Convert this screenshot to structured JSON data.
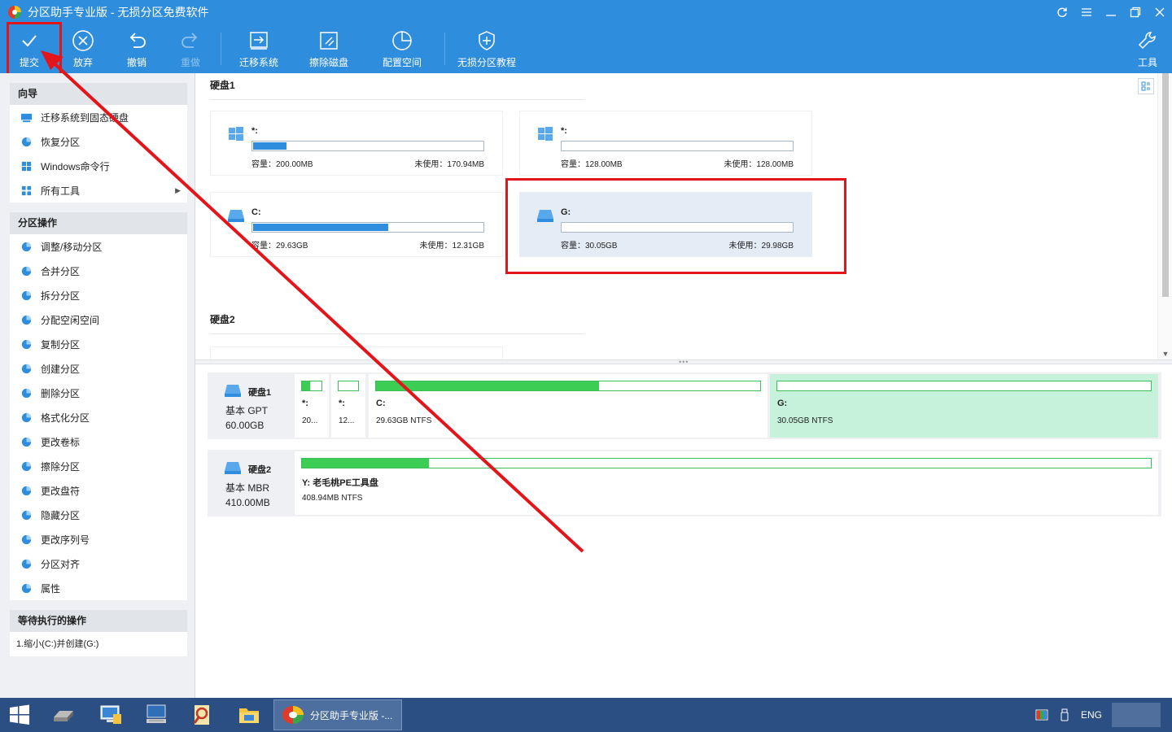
{
  "window": {
    "title": "分区助手专业版 - 无损分区免费软件",
    "controls": [
      "refresh-icon",
      "menu-icon",
      "minimize-icon",
      "restore-icon",
      "close-icon"
    ]
  },
  "toolbar": {
    "submit": "提交",
    "discard": "放弃",
    "undo": "撤销",
    "redo": "重做",
    "migrate": "迁移系统",
    "wipe": "擦除磁盘",
    "allocate": "配置空间",
    "tutorial": "无损分区教程",
    "tools": "工具"
  },
  "sidebar": {
    "wizard_title": "向导",
    "wizard_items": [
      {
        "label": "迁移系统到固态硬盘",
        "icon": "migrate-ssd-icon"
      },
      {
        "label": "恢复分区",
        "icon": "recover-partition-icon"
      },
      {
        "label": "Windows命令行",
        "icon": "windows-icon"
      },
      {
        "label": "所有工具",
        "icon": "all-tools-icon"
      }
    ],
    "ops_title": "分区操作",
    "ops_items": [
      {
        "label": "调整/移动分区",
        "icon": "resize-partition-icon"
      },
      {
        "label": "合并分区",
        "icon": "merge-partition-icon"
      },
      {
        "label": "拆分分区",
        "icon": "split-partition-icon"
      },
      {
        "label": "分配空闲空间",
        "icon": "allocate-space-icon"
      },
      {
        "label": "复制分区",
        "icon": "copy-partition-icon"
      },
      {
        "label": "创建分区",
        "icon": "create-partition-icon"
      },
      {
        "label": "删除分区",
        "icon": "delete-partition-icon"
      },
      {
        "label": "格式化分区",
        "icon": "format-partition-icon"
      },
      {
        "label": "更改卷标",
        "icon": "change-label-icon"
      },
      {
        "label": "擦除分区",
        "icon": "wipe-partition-icon"
      },
      {
        "label": "更改盘符",
        "icon": "change-letter-icon"
      },
      {
        "label": "隐藏分区",
        "icon": "hide-partition-icon"
      },
      {
        "label": "更改序列号",
        "icon": "change-serial-icon"
      },
      {
        "label": "分区对齐",
        "icon": "align-partition-icon"
      },
      {
        "label": "属性",
        "icon": "properties-icon"
      }
    ],
    "pending_title": "等待执行的操作",
    "pending_items": [
      "1.缩小(C:)并创建(G:)"
    ]
  },
  "disk1": {
    "label": "硬盘1",
    "cards": [
      {
        "name": "*:",
        "capacity": "容量：200.00MB",
        "free": "未使用：170.94MB",
        "used_fraction": 0.145,
        "icon": "windows-icon"
      },
      {
        "name": "*:",
        "capacity": "容量：128.00MB",
        "free": "未使用：128.00MB",
        "used_fraction": 0.0,
        "icon": "windows-icon"
      },
      {
        "name": "C:",
        "capacity": "容量：29.63GB",
        "free": "未使用：12.31GB",
        "used_fraction": 0.585,
        "icon": "drive-icon"
      },
      {
        "name": "G:",
        "capacity": "容量：30.05GB",
        "free": "未使用：29.98GB",
        "used_fraction": 0.0,
        "icon": "drive-icon"
      }
    ]
  },
  "disk2": {
    "label": "硬盘2"
  },
  "disk_map": [
    {
      "name": "硬盘1",
      "type": "基本 GPT",
      "size": "60.00GB",
      "partitions": [
        {
          "name": "*:",
          "detail": "20...",
          "used_fraction": 0.4
        },
        {
          "name": "*:",
          "detail": "12...",
          "used_fraction": 0.0
        },
        {
          "name": "C:",
          "detail": "29.63GB NTFS",
          "used_fraction": 0.58
        },
        {
          "name": "G:",
          "detail": "30.05GB NTFS",
          "used_fraction": 0.0
        }
      ]
    },
    {
      "name": "硬盘2",
      "type": "基本 MBR",
      "size": "410.00MB",
      "partitions": [
        {
          "name": "Y: 老毛桃PE工具盘",
          "detail": "408.94MB NTFS",
          "used_fraction": 0.15
        }
      ]
    }
  ],
  "taskbar": {
    "app_label": "分区助手专业版 -...",
    "lang": "ENG"
  },
  "colors": {
    "title_blue": "#2f8ddd",
    "annotation_red": "#e4141b",
    "used_green": "#3cce54",
    "selected_green": "#c6f2db"
  }
}
